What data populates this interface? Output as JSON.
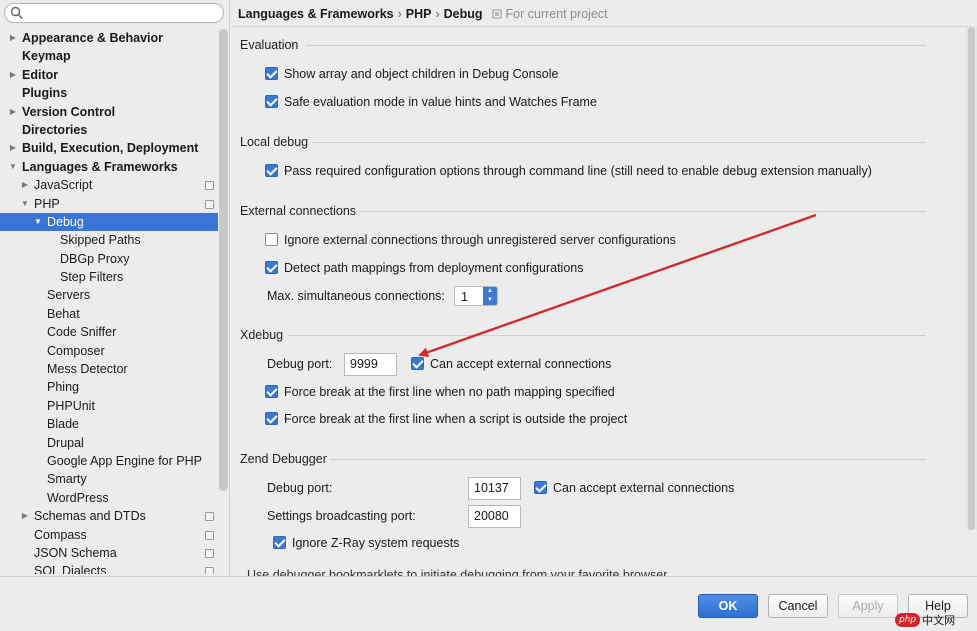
{
  "search": {
    "value": ""
  },
  "tree": [
    {
      "label": "Appearance & Behavior",
      "bold": true,
      "indent": 0,
      "arrow": "right"
    },
    {
      "label": "Keymap",
      "bold": true,
      "indent": 0,
      "arrow": ""
    },
    {
      "label": "Editor",
      "bold": true,
      "indent": 0,
      "arrow": "right"
    },
    {
      "label": "Plugins",
      "bold": true,
      "indent": 0,
      "arrow": ""
    },
    {
      "label": "Version Control",
      "bold": true,
      "indent": 0,
      "arrow": "right"
    },
    {
      "label": "Directories",
      "bold": true,
      "indent": 0,
      "arrow": ""
    },
    {
      "label": "Build, Execution, Deployment",
      "bold": true,
      "indent": 0,
      "arrow": "right"
    },
    {
      "label": "Languages & Frameworks",
      "bold": true,
      "indent": 0,
      "arrow": "down"
    },
    {
      "label": "JavaScript",
      "indent": 1,
      "arrow": "right",
      "proj": true
    },
    {
      "label": "PHP",
      "indent": 1,
      "arrow": "down",
      "proj": true
    },
    {
      "label": "Debug",
      "indent": 2,
      "arrow": "down",
      "selected": true
    },
    {
      "label": "Skipped Paths",
      "indent": 3,
      "arrow": ""
    },
    {
      "label": "DBGp Proxy",
      "indent": 3,
      "arrow": ""
    },
    {
      "label": "Step Filters",
      "indent": 3,
      "arrow": ""
    },
    {
      "label": "Servers",
      "indent": 2,
      "arrow": ""
    },
    {
      "label": "Behat",
      "indent": 2,
      "arrow": ""
    },
    {
      "label": "Code Sniffer",
      "indent": 2,
      "arrow": ""
    },
    {
      "label": "Composer",
      "indent": 2,
      "arrow": ""
    },
    {
      "label": "Mess Detector",
      "indent": 2,
      "arrow": ""
    },
    {
      "label": "Phing",
      "indent": 2,
      "arrow": ""
    },
    {
      "label": "PHPUnit",
      "indent": 2,
      "arrow": ""
    },
    {
      "label": "Blade",
      "indent": 2,
      "arrow": ""
    },
    {
      "label": "Drupal",
      "indent": 2,
      "arrow": ""
    },
    {
      "label": "Google App Engine for PHP",
      "indent": 2,
      "arrow": ""
    },
    {
      "label": "Smarty",
      "indent": 2,
      "arrow": ""
    },
    {
      "label": "WordPress",
      "indent": 2,
      "arrow": ""
    },
    {
      "label": "Schemas and DTDs",
      "indent": 1,
      "arrow": "right",
      "proj": true
    },
    {
      "label": "Compass",
      "indent": 1,
      "arrow": "",
      "proj": true
    },
    {
      "label": "JSON Schema",
      "indent": 1,
      "arrow": "",
      "proj": true
    },
    {
      "label": "SQL Dialects",
      "indent": 1,
      "arrow": "",
      "proj": true
    }
  ],
  "breadcrumb": {
    "part1": "Languages & Frameworks",
    "sep": "›",
    "part2": "PHP",
    "part3": "Debug",
    "note": "For current project"
  },
  "evaluation": {
    "title": "Evaluation",
    "show_array": {
      "label": "Show array and object children in Debug Console",
      "checked": true
    },
    "safe_eval": {
      "label": "Safe evaluation mode in value hints and Watches Frame",
      "checked": true
    }
  },
  "local_debug": {
    "title": "Local debug",
    "pass_options": {
      "label": "Pass required configuration options through command line (still need to enable debug extension manually)",
      "checked": true
    }
  },
  "external": {
    "title": "External connections",
    "ignore": {
      "label": "Ignore external connections through unregistered server configurations",
      "checked": false
    },
    "detect": {
      "label": "Detect path mappings from deployment configurations",
      "checked": true
    },
    "max_label": "Max. simultaneous connections:",
    "max_value": "1"
  },
  "xdebug": {
    "title": "Xdebug",
    "port_label": "Debug port:",
    "port_value": "9999",
    "accept": {
      "label": "Can accept external connections",
      "checked": true
    },
    "force_no_mapping": {
      "label": "Force break at the first line when no path mapping specified",
      "checked": true
    },
    "force_outside": {
      "label": "Force break at the first line when a script is outside the project",
      "checked": true
    }
  },
  "zend": {
    "title": "Zend Debugger",
    "port_label": "Debug port:",
    "port_value": "10137",
    "accept": {
      "label": "Can accept external connections",
      "checked": true
    },
    "broadcast_label": "Settings broadcasting port:",
    "broadcast_value": "20080",
    "ignore_zray": {
      "label": "Ignore Z-Ray system requests",
      "checked": true
    }
  },
  "cut_text": "Use debugger bookmarklets to initiate debugging from your favorite browser",
  "footer": {
    "ok": "OK",
    "cancel": "Cancel",
    "apply": "Apply",
    "help": "Help"
  },
  "watermark": {
    "logo": "php",
    "text": "中文网"
  },
  "colors": {
    "selection": "#3875d7",
    "checkbox": "#3b79d6",
    "arrow": "#d42a2a"
  }
}
